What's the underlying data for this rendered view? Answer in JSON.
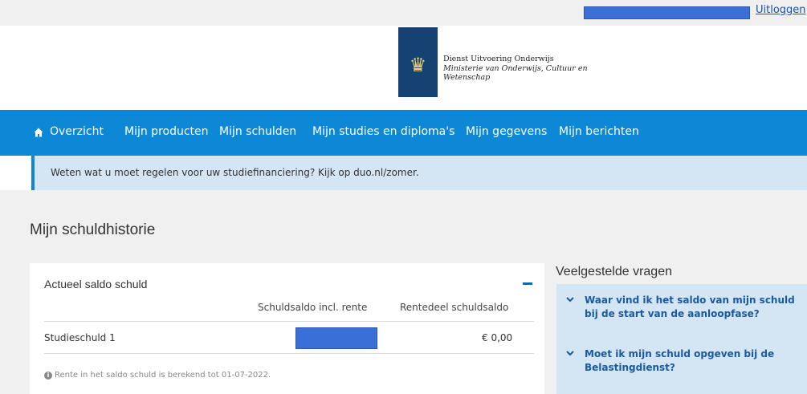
{
  "topbar": {
    "logout_label": "Uitloggen"
  },
  "logo": {
    "line1": "Dienst Uitvoering Onderwijs",
    "line2": "Ministerie van Onderwijs, Cultuur en",
    "line3": "Wetenschap"
  },
  "nav": {
    "items": [
      {
        "label": "Overzicht",
        "icon": "home-icon"
      },
      {
        "label": "Mijn producten"
      },
      {
        "label": "Mijn schulden"
      },
      {
        "label": "Mijn studies en diploma's"
      },
      {
        "label": "Mijn gegevens"
      },
      {
        "label": "Mijn berichten"
      }
    ]
  },
  "alert": {
    "text": "Weten wat u moet regelen voor uw studiefinanciering? Kijk op duo.nl/zomer."
  },
  "page": {
    "title": "Mijn schuldhistorie"
  },
  "card": {
    "title": "Actueel saldo schuld",
    "columns": [
      "Schuldsaldo incl. rente",
      "Rentedeel schuldsaldo"
    ],
    "rows": [
      {
        "label": "Studieschuld 1",
        "rentedeel": "€ 0,00"
      }
    ],
    "footnote": "Rente in het saldo schuld is berekend tot 01-07-2022."
  },
  "faq": {
    "title": "Veelgestelde vragen",
    "items": [
      {
        "question": "Waar vind ik het saldo van mijn schuld bij de start van de aanloopfase?"
      },
      {
        "question": "Moet ik mijn schuld opgeven bij de Belastingdienst?"
      }
    ]
  },
  "colors": {
    "nav_bg": "#0d88d6",
    "alert_bg": "#d4e5f4",
    "logo_bg": "#154273",
    "redaction": "#3b6fd8",
    "link": "#1a5aa0"
  }
}
